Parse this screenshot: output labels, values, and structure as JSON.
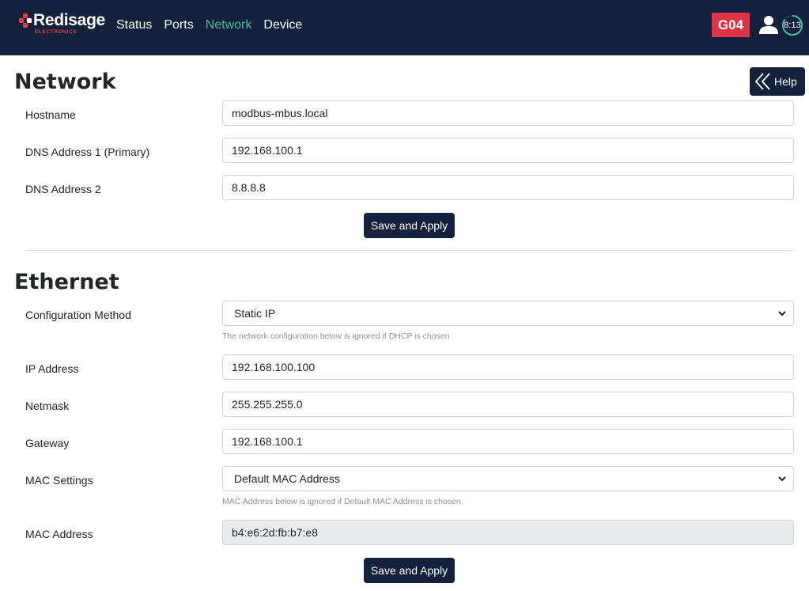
{
  "navbar": {
    "brand": "Redisage",
    "brand_sub": "ELECTRONICS",
    "links": [
      "Status",
      "Ports",
      "Network",
      "Device"
    ],
    "active_link": "Network",
    "badge": "G04",
    "timer": "8:13",
    "timer_fraction": 0.85
  },
  "help": {
    "label": "Help"
  },
  "network": {
    "title": "Network",
    "hostname_label": "Hostname",
    "hostname_value": "modbus-mbus.local",
    "dns1_label": "DNS Address 1 (Primary)",
    "dns1_value": "192.168.100.1",
    "dns2_label": "DNS Address 2",
    "dns2_value": "8.8.8.8",
    "save_label": "Save and Apply"
  },
  "ethernet": {
    "title": "Ethernet",
    "config_label": "Configuration Method",
    "config_value": "Static IP",
    "config_help": "The network configuration below is ignored if DHCP is chosen",
    "ip_label": "IP Address",
    "ip_value": "192.168.100.100",
    "netmask_label": "Netmask",
    "netmask_value": "255.255.255.0",
    "gateway_label": "Gateway",
    "gateway_value": "192.168.100.1",
    "mac_settings_label": "MAC Settings",
    "mac_settings_value": "Default MAC Address",
    "mac_help": "MAC Address below is ignored if Default MAC Address is chosen.",
    "mac_label": "MAC Address",
    "mac_value": "b4:e6:2d:fb:b7:e8",
    "save_label": "Save and Apply"
  },
  "colors": {
    "navbar_bg": "#13213c",
    "active_link": "#3fbf9a",
    "badge_bg": "#dc3545",
    "brand_accent": "#e63946"
  },
  "icons": {
    "logo": "redisage-logo-icon",
    "user": "user-icon",
    "timer": "session-timer-icon",
    "help": "double-chevron-left-icon",
    "select": "chevron-down-icon"
  }
}
